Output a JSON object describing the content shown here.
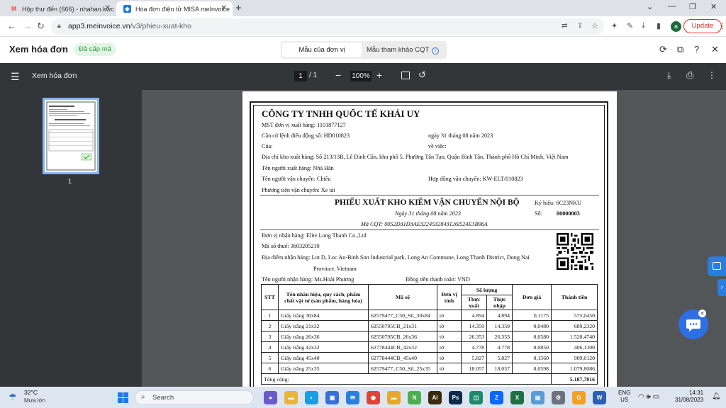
{
  "browser": {
    "tabs": [
      {
        "label": "Hộp thư đến (666) - nhahan.kwc",
        "icon": "gmail-icon"
      },
      {
        "label": "Hóa đơn điện tử MISA meInvoice",
        "icon": "misa-icon"
      }
    ],
    "url_host": "app3.meinvoice.vn",
    "url_path": "/v3/phieu-xuat-kho",
    "profile_initial": "a",
    "update_label": "Update"
  },
  "app": {
    "title": "Xem hóa đơn",
    "status_badge": "Đã cấp mã",
    "toggle": {
      "active": "Mẫu của đơn vị",
      "inactive": "Mẫu tham khảo CQT"
    }
  },
  "pdf": {
    "title": "Xem hóa đơn",
    "current_page": "1",
    "total_pages": "/ 1",
    "zoom": "100%",
    "thumbnail_label": "1"
  },
  "document": {
    "company": "CÔNG TY TNHH QUỐC TẾ KHẢI UY",
    "mst": "MST đơn vị xuất hàng: 1101877127",
    "order_ref": "Căn cứ lệnh điều động số: HD010823",
    "order_date": "ngày 31  tháng  08  năm  2023",
    "cua": "Của:",
    "ve_viec": "về việc:",
    "warehouse_address": "Địa chỉ kho xuất hàng: Số 213/13B, Lê Đình Cẩn, khu phố 5, Phường Tân Tạo, Quận Bình Tân, Thành phố Hồ Chí Minh, Việt Nam",
    "issuer": "Tên người xuất hàng: Nhã Hân",
    "transporter": "Tên người vận chuyển: Chiêu",
    "transport_contract": "Hợp đồng vận chuyển: KW-ELT/010823",
    "vehicle": "Phương tiện vận chuyển: Xe tải",
    "doc_title": "PHIẾU XUẤT KHO KIÊM VẬN CHUYỂN NỘI BỘ",
    "symbol": "Ký hiệu: 6C23NKU",
    "doc_date": "Ngày 31 tháng 08 năm 2023",
    "number_label": "Số:",
    "number_value": "00000003",
    "cqt_code": "Mã CQT: 0052D31D3AE3224532843126l524E3B96A",
    "receiver_unit": "Đơn vị nhận hàng: Elite Long Thanh Co.,Ltd",
    "tax_code": "Mã số thuế: 3603205210",
    "receive_address_1": "Địa điểm nhận hàng: Lot D, Loc An-Binh Son Industrial park, Long An Commune, Long Thanh District, Dong Nai",
    "receive_address_2": "Province, Vietnam",
    "receiver_name": "Tên người nhận hàng: Ms.Hoài Phương",
    "currency": "Đồng tiền thanh toán: VND",
    "table": {
      "headers": {
        "stt": "STT",
        "name": "Tên nhãn hiệu, quy cách, phẩm chất vật tư (sản phẩm, hàng hóa)",
        "code": "Mã số",
        "unit": "Đơn vị tính",
        "qty": "Số lượng",
        "qty_out": "Thực xuất",
        "qty_in": "Thực nhập",
        "price": "Đơn giá",
        "amount": "Thành tiền"
      },
      "rows": [
        {
          "stt": "1",
          "name": "Giấy trắng 30x84",
          "code": "62579477_C50_Sil_30x84",
          "unit": "tờ",
          "out": "4.894",
          "in": "4.894",
          "price": "0,1175",
          "amount": "575,0450"
        },
        {
          "stt": "2",
          "name": "Giấy trắng 21x32",
          "code": "62550795CB_21x31",
          "unit": "tờ",
          "out": "14.359",
          "in": "14.359",
          "price": "0,0480",
          "amount": "689,2320"
        },
        {
          "stt": "3",
          "name": "Giấy trắng 26x36",
          "code": "62550795CB_26x36",
          "unit": "tờ",
          "out": "26.353",
          "in": "26.353",
          "price": "0,0580",
          "amount": "1.528,4740"
        },
        {
          "stt": "4",
          "name": "Giấy trắng 42x32",
          "code": "62778444CB_42x32",
          "unit": "tờ",
          "out": "4.778",
          "in": "4.778",
          "price": "0,0850",
          "amount": "406,1300"
        },
        {
          "stt": "5",
          "name": "Giấy trắng 45x40",
          "code": "62778444CB_45x40",
          "unit": "tờ",
          "out": "5.827",
          "in": "5.827",
          "price": "0,1560",
          "amount": "909,0120"
        },
        {
          "stt": "6",
          "name": "Giấy trắng 25x35",
          "code": "62579477_C50_Sil_25x35",
          "unit": "tờ",
          "out": "18.057",
          "in": "18.057",
          "price": "0,0598",
          "amount": "1.079,8086"
        }
      ],
      "total_label": "Tổng cộng:",
      "total_value": "5.187,7016"
    }
  },
  "taskbar": {
    "temperature": "32°C",
    "condition": "Mưa lớn",
    "search_label": "Search",
    "lang_1": "ENG",
    "lang_2": "US",
    "time": "14:31",
    "date": "31/08/2023",
    "apps": [
      {
        "name": "meet-app",
        "glyph": "●",
        "color": "#6a5acd"
      },
      {
        "name": "file-explorer",
        "glyph": "▬",
        "color": "#e8b43a"
      },
      {
        "name": "edge-app",
        "glyph": "◐",
        "color": "#1b9de2"
      },
      {
        "name": "store-app",
        "glyph": "▣",
        "color": "#3b6fd8"
      },
      {
        "name": "mail-app",
        "glyph": "✉",
        "color": "#2b7de0"
      },
      {
        "name": "chrome-app",
        "glyph": "◉",
        "color": "#db4437"
      },
      {
        "name": "folder-app",
        "glyph": "▬",
        "color": "#e6a72b"
      },
      {
        "name": "nitro-app",
        "glyph": "N",
        "color": "#4caf50"
      },
      {
        "name": "illustrator-app",
        "glyph": "Ai",
        "color": "#3a2a10"
      },
      {
        "name": "photoshop-app",
        "glyph": "Ps",
        "color": "#0e2a4a"
      },
      {
        "name": "ms-app",
        "glyph": "◫",
        "color": "#1c8b6b"
      },
      {
        "name": "zalo-app",
        "glyph": "Z",
        "color": "#0a68ff"
      },
      {
        "name": "excel-app",
        "glyph": "X",
        "color": "#1d7044"
      },
      {
        "name": "photos-app",
        "glyph": "▤",
        "color": "#5b9bd5"
      },
      {
        "name": "settings-app",
        "glyph": "⚙",
        "color": "#6b7280"
      },
      {
        "name": "gmail-app",
        "glyph": "G",
        "color": "#f4a022"
      },
      {
        "name": "word-app",
        "glyph": "W",
        "color": "#2b5fb4"
      }
    ]
  }
}
